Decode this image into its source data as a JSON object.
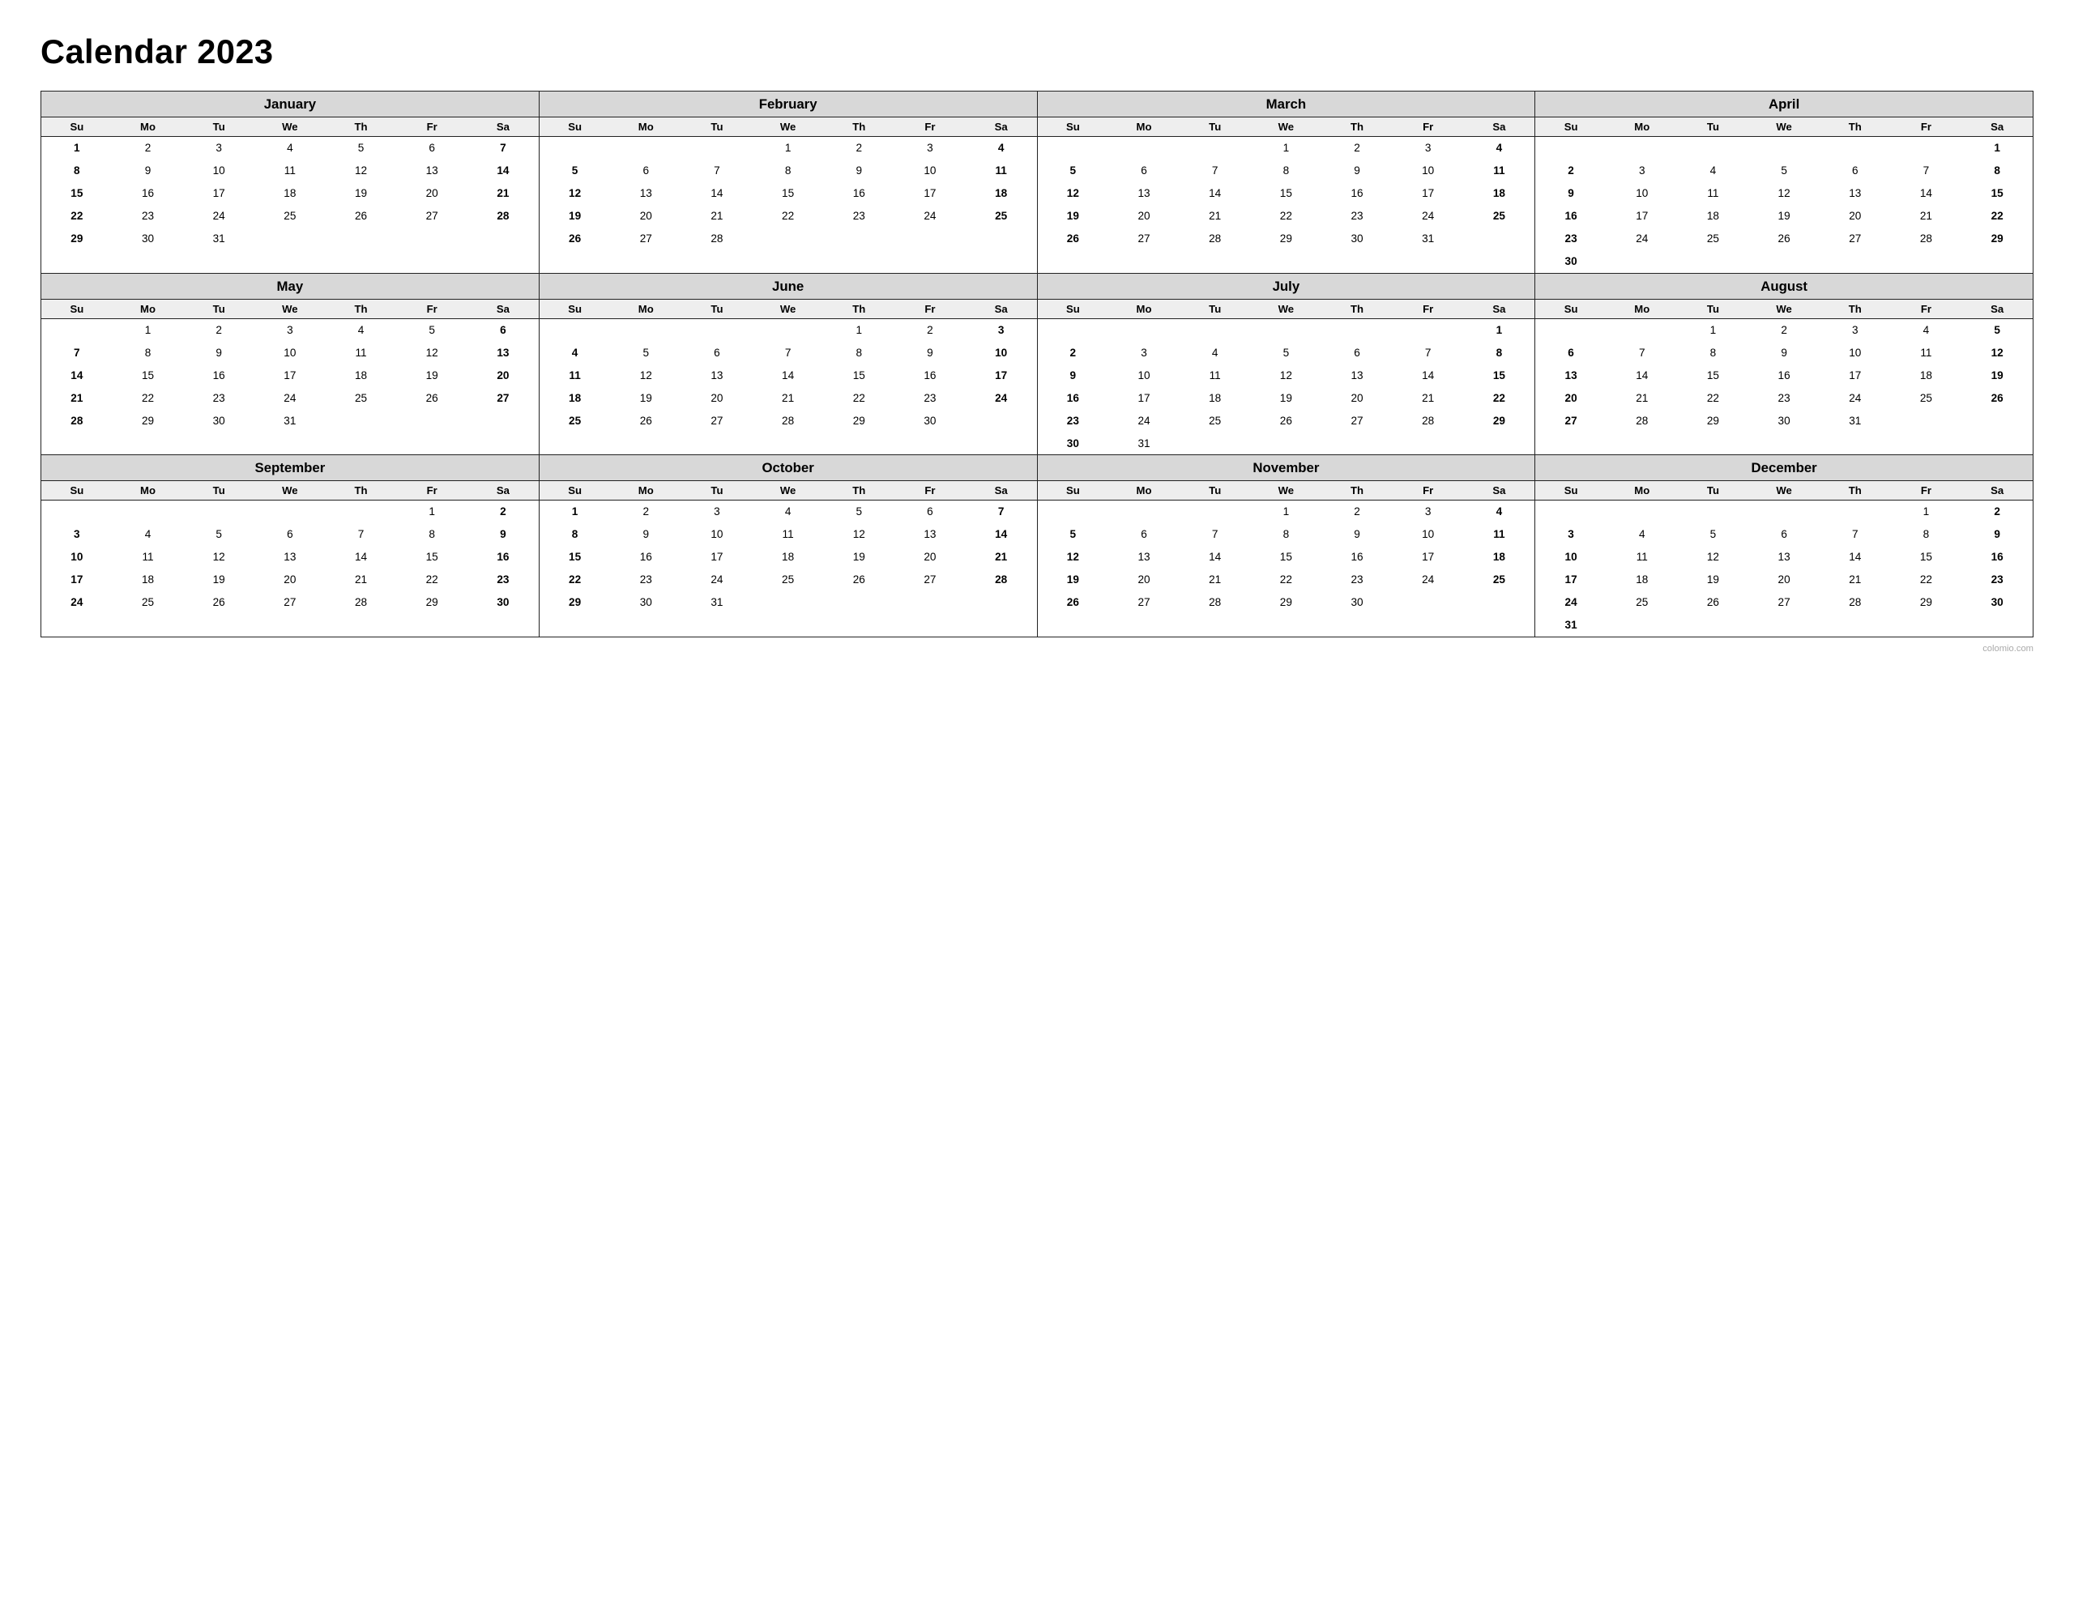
{
  "title": "Calendar 2023",
  "watermark": "colomio.com",
  "months": [
    {
      "name": "January",
      "weeks": [
        [
          "",
          "",
          "",
          "",
          "",
          "",
          "7"
        ],
        [
          "1",
          "2",
          "3",
          "4",
          "5",
          "6",
          "7"
        ],
        [
          "8",
          "9",
          "10",
          "11",
          "12",
          "13",
          "14"
        ],
        [
          "15",
          "16",
          "17",
          "18",
          "19",
          "20",
          "21"
        ],
        [
          "22",
          "23",
          "24",
          "25",
          "26",
          "27",
          "28"
        ],
        [
          "29",
          "30",
          "31",
          "",
          "",
          "",
          ""
        ]
      ],
      "startDay": 0,
      "days": [
        1,
        2,
        3,
        4,
        5,
        6,
        7,
        8,
        9,
        10,
        11,
        12,
        13,
        14,
        15,
        16,
        17,
        18,
        19,
        20,
        21,
        22,
        23,
        24,
        25,
        26,
        27,
        28,
        29,
        30,
        31
      ]
    },
    {
      "name": "February",
      "days": [
        1,
        2,
        3,
        4,
        5,
        6,
        7,
        8,
        9,
        10,
        11,
        12,
        13,
        14,
        15,
        16,
        17,
        18,
        19,
        20,
        21,
        22,
        23,
        24,
        25,
        26,
        27,
        28
      ]
    },
    {
      "name": "March",
      "days": [
        1,
        2,
        3,
        4,
        5,
        6,
        7,
        8,
        9,
        10,
        11,
        12,
        13,
        14,
        15,
        16,
        17,
        18,
        19,
        20,
        21,
        22,
        23,
        24,
        25,
        26,
        27,
        28,
        29,
        30,
        31
      ]
    },
    {
      "name": "April",
      "days": [
        1,
        2,
        3,
        4,
        5,
        6,
        7,
        8,
        9,
        10,
        11,
        12,
        13,
        14,
        15,
        16,
        17,
        18,
        19,
        20,
        21,
        22,
        23,
        24,
        25,
        26,
        27,
        28,
        29,
        30
      ]
    },
    {
      "name": "May",
      "days": [
        1,
        2,
        3,
        4,
        5,
        6,
        7,
        8,
        9,
        10,
        11,
        12,
        13,
        14,
        15,
        16,
        17,
        18,
        19,
        20,
        21,
        22,
        23,
        24,
        25,
        26,
        27,
        28,
        29,
        30,
        31
      ]
    },
    {
      "name": "June",
      "days": [
        1,
        2,
        3,
        4,
        5,
        6,
        7,
        8,
        9,
        10,
        11,
        12,
        13,
        14,
        15,
        16,
        17,
        18,
        19,
        20,
        21,
        22,
        23,
        24,
        25,
        26,
        27,
        28,
        29,
        30
      ]
    },
    {
      "name": "July",
      "days": [
        1,
        2,
        3,
        4,
        5,
        6,
        7,
        8,
        9,
        10,
        11,
        12,
        13,
        14,
        15,
        16,
        17,
        18,
        19,
        20,
        21,
        22,
        23,
        24,
        25,
        26,
        27,
        28,
        29,
        30,
        31
      ]
    },
    {
      "name": "August",
      "days": [
        1,
        2,
        3,
        4,
        5,
        6,
        7,
        8,
        9,
        10,
        11,
        12,
        13,
        14,
        15,
        16,
        17,
        18,
        19,
        20,
        21,
        22,
        23,
        24,
        25,
        26,
        27,
        28,
        29,
        30,
        31
      ]
    },
    {
      "name": "September",
      "days": [
        1,
        2,
        3,
        4,
        5,
        6,
        7,
        8,
        9,
        10,
        11,
        12,
        13,
        14,
        15,
        16,
        17,
        18,
        19,
        20,
        21,
        22,
        23,
        24,
        25,
        26,
        27,
        28,
        29,
        30
      ]
    },
    {
      "name": "October",
      "days": [
        1,
        2,
        3,
        4,
        5,
        6,
        7,
        8,
        9,
        10,
        11,
        12,
        13,
        14,
        15,
        16,
        17,
        18,
        19,
        20,
        21,
        22,
        23,
        24,
        25,
        26,
        27,
        28,
        29,
        30,
        31
      ]
    },
    {
      "name": "November",
      "days": [
        1,
        2,
        3,
        4,
        5,
        6,
        7,
        8,
        9,
        10,
        11,
        12,
        13,
        14,
        15,
        16,
        17,
        18,
        19,
        20,
        21,
        22,
        23,
        24,
        25,
        26,
        27,
        28,
        29,
        30
      ]
    },
    {
      "name": "December",
      "days": [
        1,
        2,
        3,
        4,
        5,
        6,
        7,
        8,
        9,
        10,
        11,
        12,
        13,
        14,
        15,
        16,
        17,
        18,
        19,
        20,
        21,
        22,
        23,
        24,
        25,
        26,
        27,
        28,
        29,
        30,
        31
      ]
    }
  ],
  "dayHeaders": [
    "Su",
    "Mo",
    "Tu",
    "We",
    "Th",
    "Fr",
    "Sa"
  ],
  "startDays": {
    "January": 0,
    "February": 3,
    "March": 3,
    "April": 6,
    "May": 1,
    "June": 4,
    "July": 6,
    "August": 2,
    "September": 5,
    "October": 0,
    "November": 3,
    "December": 5
  }
}
